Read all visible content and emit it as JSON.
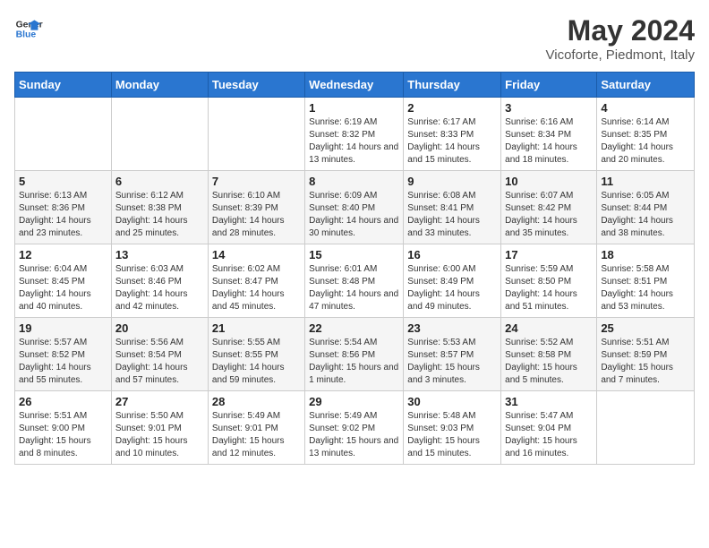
{
  "logo": {
    "line1": "General",
    "line2": "Blue"
  },
  "title": "May 2024",
  "subtitle": "Vicoforte, Piedmont, Italy",
  "days_of_week": [
    "Sunday",
    "Monday",
    "Tuesday",
    "Wednesday",
    "Thursday",
    "Friday",
    "Saturday"
  ],
  "weeks": [
    [
      {
        "day": "",
        "info": ""
      },
      {
        "day": "",
        "info": ""
      },
      {
        "day": "",
        "info": ""
      },
      {
        "day": "1",
        "info": "Sunrise: 6:19 AM\nSunset: 8:32 PM\nDaylight: 14 hours and 13 minutes."
      },
      {
        "day": "2",
        "info": "Sunrise: 6:17 AM\nSunset: 8:33 PM\nDaylight: 14 hours and 15 minutes."
      },
      {
        "day": "3",
        "info": "Sunrise: 6:16 AM\nSunset: 8:34 PM\nDaylight: 14 hours and 18 minutes."
      },
      {
        "day": "4",
        "info": "Sunrise: 6:14 AM\nSunset: 8:35 PM\nDaylight: 14 hours and 20 minutes."
      }
    ],
    [
      {
        "day": "5",
        "info": "Sunrise: 6:13 AM\nSunset: 8:36 PM\nDaylight: 14 hours and 23 minutes."
      },
      {
        "day": "6",
        "info": "Sunrise: 6:12 AM\nSunset: 8:38 PM\nDaylight: 14 hours and 25 minutes."
      },
      {
        "day": "7",
        "info": "Sunrise: 6:10 AM\nSunset: 8:39 PM\nDaylight: 14 hours and 28 minutes."
      },
      {
        "day": "8",
        "info": "Sunrise: 6:09 AM\nSunset: 8:40 PM\nDaylight: 14 hours and 30 minutes."
      },
      {
        "day": "9",
        "info": "Sunrise: 6:08 AM\nSunset: 8:41 PM\nDaylight: 14 hours and 33 minutes."
      },
      {
        "day": "10",
        "info": "Sunrise: 6:07 AM\nSunset: 8:42 PM\nDaylight: 14 hours and 35 minutes."
      },
      {
        "day": "11",
        "info": "Sunrise: 6:05 AM\nSunset: 8:44 PM\nDaylight: 14 hours and 38 minutes."
      }
    ],
    [
      {
        "day": "12",
        "info": "Sunrise: 6:04 AM\nSunset: 8:45 PM\nDaylight: 14 hours and 40 minutes."
      },
      {
        "day": "13",
        "info": "Sunrise: 6:03 AM\nSunset: 8:46 PM\nDaylight: 14 hours and 42 minutes."
      },
      {
        "day": "14",
        "info": "Sunrise: 6:02 AM\nSunset: 8:47 PM\nDaylight: 14 hours and 45 minutes."
      },
      {
        "day": "15",
        "info": "Sunrise: 6:01 AM\nSunset: 8:48 PM\nDaylight: 14 hours and 47 minutes."
      },
      {
        "day": "16",
        "info": "Sunrise: 6:00 AM\nSunset: 8:49 PM\nDaylight: 14 hours and 49 minutes."
      },
      {
        "day": "17",
        "info": "Sunrise: 5:59 AM\nSunset: 8:50 PM\nDaylight: 14 hours and 51 minutes."
      },
      {
        "day": "18",
        "info": "Sunrise: 5:58 AM\nSunset: 8:51 PM\nDaylight: 14 hours and 53 minutes."
      }
    ],
    [
      {
        "day": "19",
        "info": "Sunrise: 5:57 AM\nSunset: 8:52 PM\nDaylight: 14 hours and 55 minutes."
      },
      {
        "day": "20",
        "info": "Sunrise: 5:56 AM\nSunset: 8:54 PM\nDaylight: 14 hours and 57 minutes."
      },
      {
        "day": "21",
        "info": "Sunrise: 5:55 AM\nSunset: 8:55 PM\nDaylight: 14 hours and 59 minutes."
      },
      {
        "day": "22",
        "info": "Sunrise: 5:54 AM\nSunset: 8:56 PM\nDaylight: 15 hours and 1 minute."
      },
      {
        "day": "23",
        "info": "Sunrise: 5:53 AM\nSunset: 8:57 PM\nDaylight: 15 hours and 3 minutes."
      },
      {
        "day": "24",
        "info": "Sunrise: 5:52 AM\nSunset: 8:58 PM\nDaylight: 15 hours and 5 minutes."
      },
      {
        "day": "25",
        "info": "Sunrise: 5:51 AM\nSunset: 8:59 PM\nDaylight: 15 hours and 7 minutes."
      }
    ],
    [
      {
        "day": "26",
        "info": "Sunrise: 5:51 AM\nSunset: 9:00 PM\nDaylight: 15 hours and 8 minutes."
      },
      {
        "day": "27",
        "info": "Sunrise: 5:50 AM\nSunset: 9:01 PM\nDaylight: 15 hours and 10 minutes."
      },
      {
        "day": "28",
        "info": "Sunrise: 5:49 AM\nSunset: 9:01 PM\nDaylight: 15 hours and 12 minutes."
      },
      {
        "day": "29",
        "info": "Sunrise: 5:49 AM\nSunset: 9:02 PM\nDaylight: 15 hours and 13 minutes."
      },
      {
        "day": "30",
        "info": "Sunrise: 5:48 AM\nSunset: 9:03 PM\nDaylight: 15 hours and 15 minutes."
      },
      {
        "day": "31",
        "info": "Sunrise: 5:47 AM\nSunset: 9:04 PM\nDaylight: 15 hours and 16 minutes."
      },
      {
        "day": "",
        "info": ""
      }
    ]
  ]
}
